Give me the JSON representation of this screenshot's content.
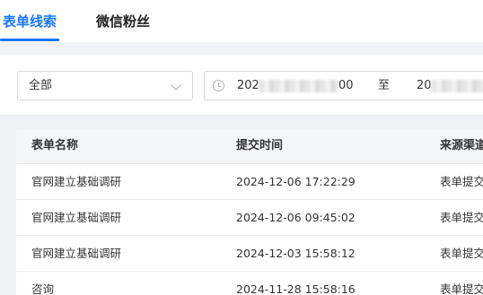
{
  "tabs": [
    {
      "label": "表单线索",
      "active": true
    },
    {
      "label": "微信粉丝",
      "active": false
    }
  ],
  "filter": {
    "source_select_value": "全部",
    "date_start": "202",
    "date_start_tail": "00",
    "date_separator": "至",
    "date_end": "20"
  },
  "table": {
    "columns": [
      "表单名称",
      "提交时间",
      "来源渠道"
    ],
    "rows": [
      {
        "name": "官网建立基础调研",
        "time": "2024-12-06 17:22:29",
        "source": "表单提交"
      },
      {
        "name": "官网建立基础调研",
        "time": "2024-12-06 09:45:02",
        "source": "表单提交"
      },
      {
        "name": "官网建立基础调研",
        "time": "2024-12-03 15:58:12",
        "source": "表单提交"
      },
      {
        "name": "咨询",
        "time": "2024-11-28 15:58:16",
        "source": "表单提交"
      }
    ]
  },
  "colors": {
    "accent": "#1677ff",
    "page_background": "#f0f2f5",
    "header_background": "#f5f6f8"
  },
  "icons": {
    "date": "clock-icon",
    "select": "chevron-down-icon"
  }
}
